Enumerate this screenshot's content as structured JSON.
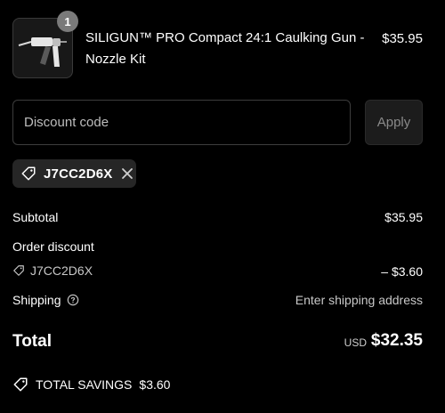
{
  "cart": {
    "item": {
      "quantity": "1",
      "title": "SILIGUN™ PRO Compact 24:1 Caulking Gun - Nozzle Kit",
      "price": "$35.95",
      "image_icon": "caulking-gun-icon"
    }
  },
  "discount": {
    "placeholder": "Discount code",
    "value": "",
    "apply_label": "Apply",
    "applied_code": "J7CC2D6X"
  },
  "summary": {
    "subtotal_label": "Subtotal",
    "subtotal_value": "$35.95",
    "order_discount_label": "Order discount",
    "discount_code": "J7CC2D6X",
    "discount_value": "– $3.60",
    "shipping_label": "Shipping",
    "shipping_value": "Enter shipping address",
    "total_label": "Total",
    "total_currency": "USD",
    "total_value": "$32.35",
    "savings_label": "TOTAL SAVINGS",
    "savings_value": "$3.60"
  },
  "colors": {
    "background": "#000000",
    "text": "#ffffff",
    "muted": "#c8c8c8",
    "border": "#3d3d3d",
    "chip_bg": "#262626"
  }
}
